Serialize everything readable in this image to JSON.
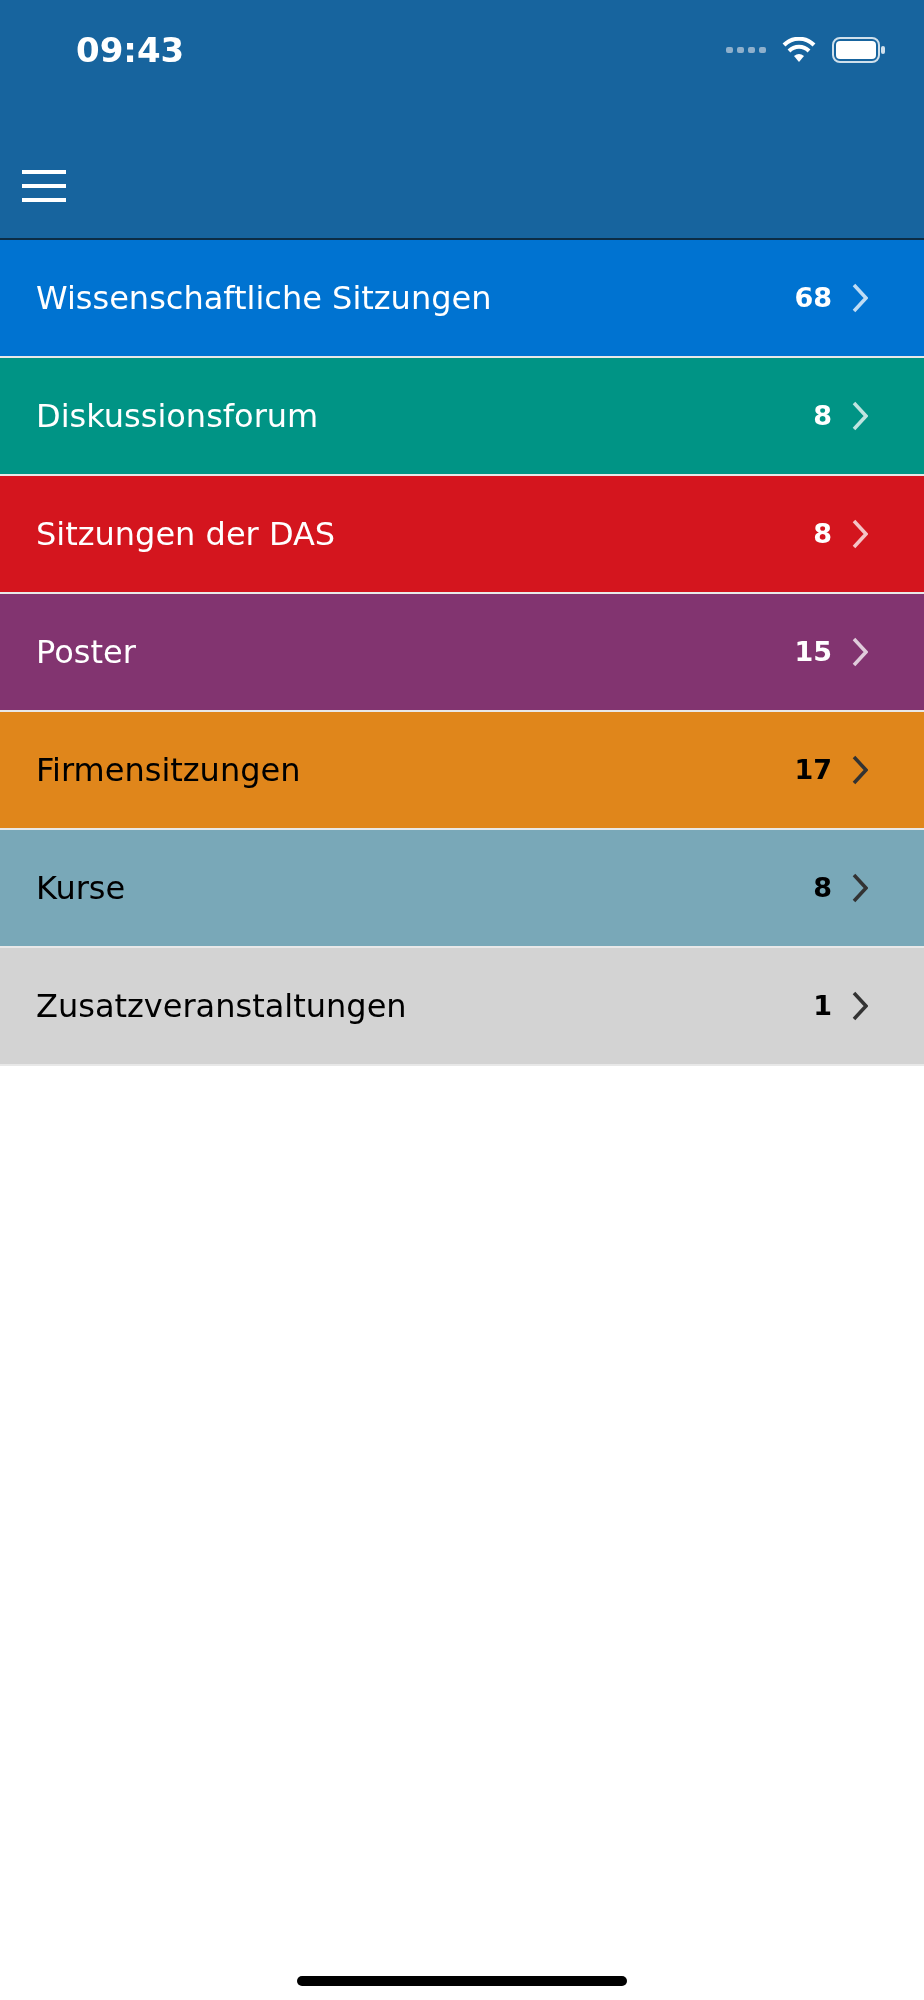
{
  "status_bar": {
    "time": "09:43"
  },
  "categories": [
    {
      "label": "Wissenschaftliche Sitzungen",
      "count": "68",
      "color": "#0073d1"
    },
    {
      "label": "Diskussionsforum",
      "count": "8",
      "color": "#009485"
    },
    {
      "label": "Sitzungen der DAS",
      "count": "8",
      "color": "#d4151e"
    },
    {
      "label": "Poster",
      "count": "15",
      "color": "#823470"
    },
    {
      "label": "Firmensitzungen",
      "count": "17",
      "color": "#e0861b"
    },
    {
      "label": "Kurse",
      "count": "8",
      "color": "#79a8b8"
    },
    {
      "label": "Zusatzveranstaltungen",
      "count": "1",
      "color": "#d3d3d3"
    }
  ]
}
